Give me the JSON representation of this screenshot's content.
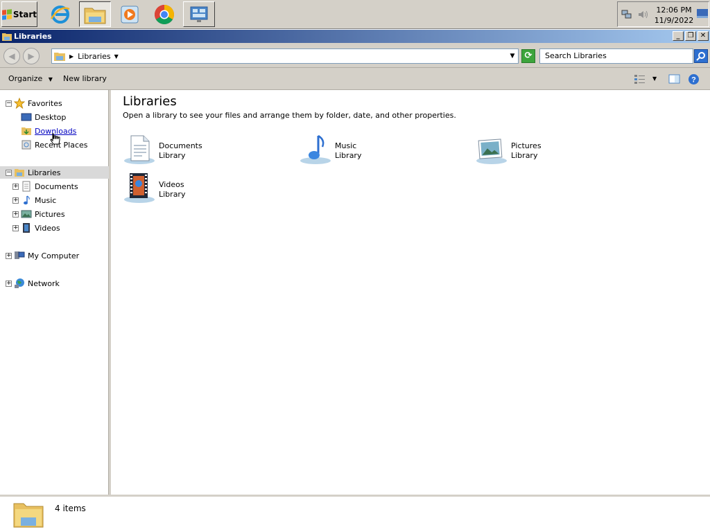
{
  "taskbar": {
    "start_label": "Start",
    "clock_time": "12:06 PM",
    "clock_date": "11/9/2022",
    "apps": [
      {
        "icon": "internet-explorer-icon"
      },
      {
        "icon": "file-explorer-icon",
        "active": true
      },
      {
        "icon": "media-player-icon"
      },
      {
        "icon": "chrome-icon"
      },
      {
        "icon": "control-panel-icon"
      }
    ],
    "tray_icons": [
      "network-icon",
      "volume-icon",
      "show-desktop-icon"
    ]
  },
  "window": {
    "title": "Libraries",
    "buttons": {
      "minimize": "_",
      "restore": "❐",
      "close": "✕"
    }
  },
  "address": {
    "breadcrumb": "Libraries",
    "search_placeholder": "Search Libraries"
  },
  "commands": {
    "organize": "Organize",
    "new_library": "New library"
  },
  "nav": {
    "favorites": "Favorites",
    "desktop": "Desktop",
    "downloads": "Downloads",
    "recent_places": "Recent Places",
    "libraries": "Libraries",
    "documents": "Documents",
    "music": "Music",
    "pictures": "Pictures",
    "videos": "Videos",
    "my_computer": "My Computer",
    "network": "Network"
  },
  "content": {
    "title": "Libraries",
    "subtitle": "Open a library to see your files and arrange them by folder, date, and other properties.",
    "libraries": [
      {
        "name": "Documents",
        "type": "Library",
        "icon": "documents-library-icon"
      },
      {
        "name": "Music",
        "type": "Library",
        "icon": "music-library-icon"
      },
      {
        "name": "Pictures",
        "type": "Library",
        "icon": "pictures-library-icon"
      },
      {
        "name": "Videos",
        "type": "Library",
        "icon": "videos-library-icon"
      }
    ]
  },
  "status": {
    "item_count": "4 items"
  },
  "colors": {
    "title_gradient_start": "#0a246a",
    "title_gradient_end": "#a6caf0",
    "chrome": "#d4d0c8",
    "link": "#0000c0"
  }
}
